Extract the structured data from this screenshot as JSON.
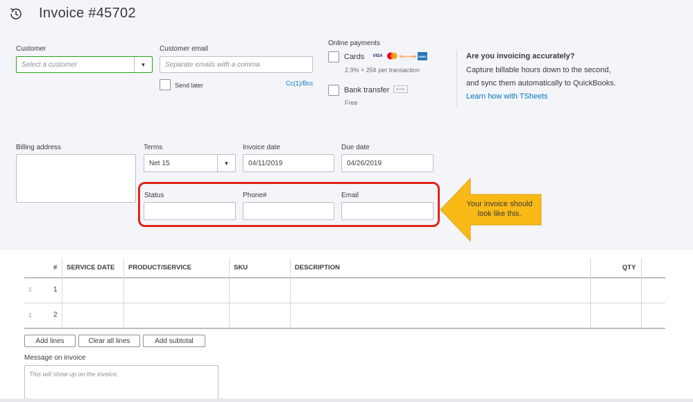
{
  "header": {
    "title": "Invoice #45702",
    "icon": "history-icon"
  },
  "customer": {
    "label": "Customer",
    "placeholder": "Select a customer"
  },
  "customer_email": {
    "label": "Customer email",
    "placeholder": "Separate emails with a comma",
    "send_later_label": "Send later",
    "cc_bcc_link": "Cc(1)/Bcc"
  },
  "online_payments": {
    "label": "Online payments",
    "cards_label": "Cards",
    "cards_fee": "2.9% + 25¢ per transaction",
    "card_logos": [
      "VISA",
      "MC",
      "DISC",
      "AMEX"
    ],
    "bank_label": "Bank transfer",
    "bank_badge": "BANK",
    "bank_fee": "Free"
  },
  "promo": {
    "title": "Are you invoicing accurately?",
    "line1": "Capture billable hours down to the second,",
    "line2": "and sync them automatically to QuickBooks.",
    "link": "Learn how with TSheets"
  },
  "billing": {
    "label": "Billing address"
  },
  "terms": {
    "label": "Terms",
    "value": "Net 15"
  },
  "invoice_date": {
    "label": "Invoice date",
    "value": "04/11/2019"
  },
  "due_date": {
    "label": "Due date",
    "value": "04/26/2019"
  },
  "custom_fields": {
    "status_label": "Status",
    "phone_label": "Phone#",
    "email_label": "Email"
  },
  "callout": {
    "line1": "Your invoice should",
    "line2": "look like this."
  },
  "table": {
    "columns": [
      "#",
      "SERVICE DATE",
      "PRODUCT/SERVICE",
      "SKU",
      "DESCRIPTION",
      "QTY"
    ],
    "rows": [
      {
        "num": "1"
      },
      {
        "num": "2"
      }
    ]
  },
  "actions": {
    "add_lines": "Add lines",
    "clear_all_lines": "Clear all lines",
    "add_subtotal": "Add subtotal"
  },
  "message": {
    "label": "Message on invoice",
    "placeholder": "This will show up on the invoice."
  },
  "colors": {
    "background_panel": "#f4f5f8",
    "link": "#0077c5",
    "highlight": "#e0241b",
    "callout": "#f9b917",
    "focus_green": "#2ca01c"
  }
}
